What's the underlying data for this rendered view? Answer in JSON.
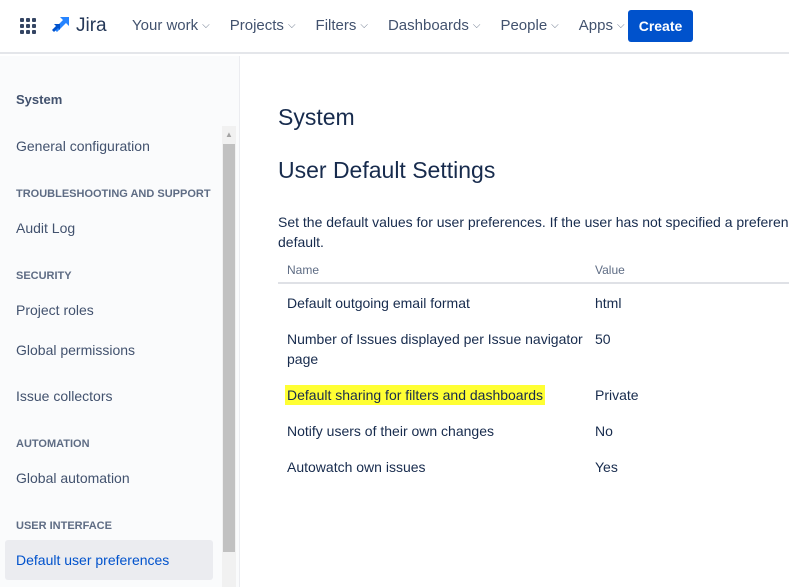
{
  "topnav": {
    "product": "Jira",
    "items": [
      "Your work",
      "Projects",
      "Filters",
      "Dashboards",
      "People",
      "Apps"
    ],
    "create": "Create"
  },
  "sidebar": {
    "title": "System",
    "items": [
      {
        "type": "item",
        "label": "General configuration"
      },
      {
        "type": "heading",
        "label": "TROUBLESHOOTING AND SUPPORT"
      },
      {
        "type": "item",
        "label": "Audit Log"
      },
      {
        "type": "heading",
        "label": "SECURITY"
      },
      {
        "type": "item",
        "label": "Project roles"
      },
      {
        "type": "item",
        "label": "Global permissions"
      },
      {
        "type": "item",
        "label": "Issue collectors"
      },
      {
        "type": "heading",
        "label": "AUTOMATION"
      },
      {
        "type": "item",
        "label": "Global automation"
      },
      {
        "type": "heading",
        "label": "USER INTERFACE"
      },
      {
        "type": "item",
        "label": "Default user preferences",
        "selected": true
      }
    ]
  },
  "main": {
    "title": "System",
    "subtitle": "User Default Settings",
    "description_line1": "Set the default values for user preferences. If the user has not specified a preference",
    "description_line2": "default.",
    "columns": [
      "Name",
      "Value"
    ],
    "rows": [
      {
        "name": "Default outgoing email format",
        "value": "html"
      },
      {
        "name_line1": "Number of Issues displayed per Issue navigator",
        "name_line2": "page",
        "value": "50"
      },
      {
        "name": "Default sharing for filters and dashboards",
        "value": "Private",
        "highlighted": true
      },
      {
        "name": "Notify users of their own changes",
        "value": "No"
      },
      {
        "name": "Autowatch own issues",
        "value": "Yes"
      }
    ]
  },
  "colors": {
    "accent": "#0052cc",
    "highlight": "#ffff33"
  }
}
